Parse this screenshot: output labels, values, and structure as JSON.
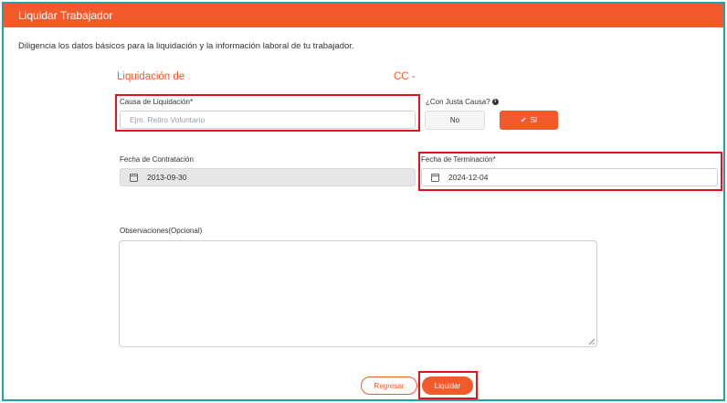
{
  "header": {
    "title": "Liquidar Trabajador"
  },
  "intro": "Diligencia los datos básicos para la liquidación y la información laboral de tu trabajador.",
  "liquidation": {
    "title": "Liquidación de",
    "cc": "CC -"
  },
  "causa": {
    "label": "Causa de Liquidación*",
    "placeholder": "Ejm. Retiro Voluntario",
    "value": ""
  },
  "justa_causa": {
    "label": "¿Con Justa Causa?",
    "info_icon": "info-icon",
    "no_label": "No",
    "si_label": "Sí",
    "check_icon": "check-icon"
  },
  "fecha_contratacion": {
    "label": "Fecha de Contratación",
    "value": "2013-09-30",
    "icon": "calendar-icon"
  },
  "fecha_terminacion": {
    "label": "Fecha de Terminación*",
    "value": "2024-12-04",
    "icon": "calendar-icon"
  },
  "observaciones": {
    "label": "Observaciones(Opcional)",
    "value": ""
  },
  "actions": {
    "regresar_label": "Regresar",
    "liquidar_label": "Liquidar"
  },
  "colors": {
    "accent": "#f25a2b",
    "highlight": "#e3121b",
    "frame": "#1fa3a8"
  }
}
